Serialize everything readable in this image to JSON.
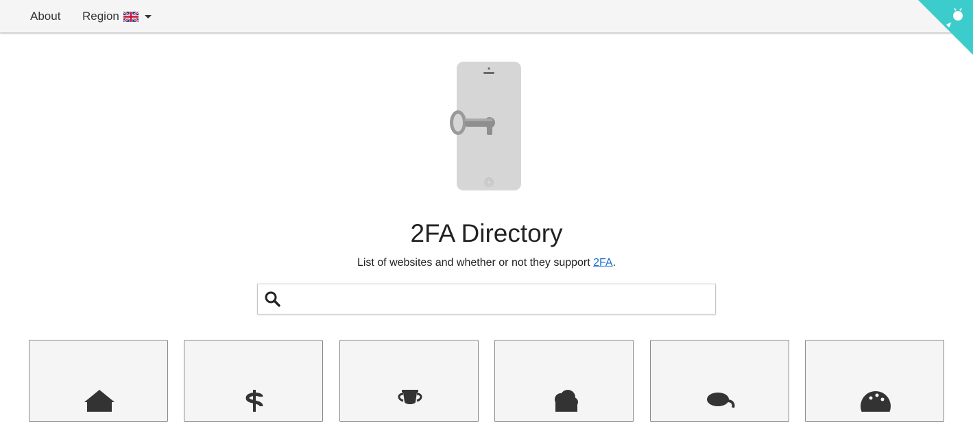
{
  "nav": {
    "about_label": "About",
    "region_label": "Region",
    "region_flag_icon": "uk-flag-icon"
  },
  "hero": {
    "title": "2FA Directory",
    "subtitle_prefix": "List of websites and whether or not they support ",
    "subtitle_link": "2FA",
    "subtitle_suffix": "."
  },
  "search": {
    "value": "",
    "placeholder": ""
  },
  "categories": [
    {
      "icon": "home-icon"
    },
    {
      "icon": "dollar-icon"
    },
    {
      "icon": "trophy-icon"
    },
    {
      "icon": "cloud-icon"
    },
    {
      "icon": "comments-icon"
    },
    {
      "icon": "palette-icon"
    }
  ],
  "colors": {
    "accent_corner": "#3ccccc",
    "link": "#1a6fd6",
    "navbar_bg": "#f5f5f5",
    "card_bg": "#f5f5f5"
  }
}
